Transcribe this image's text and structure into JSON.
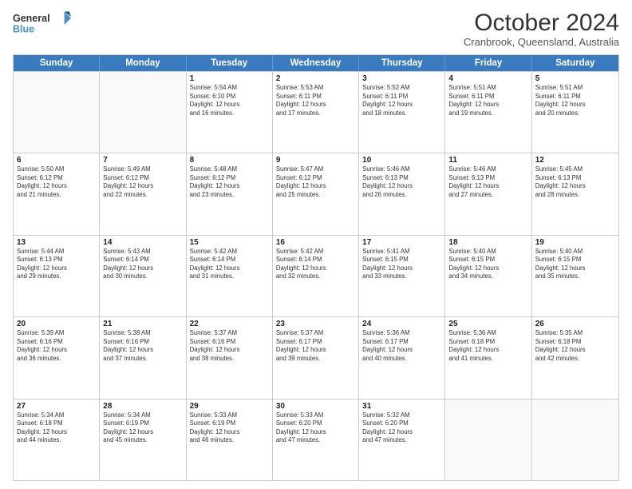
{
  "logo": {
    "line1": "General",
    "line2": "Blue",
    "icon_color": "#4a90c4"
  },
  "title": "October 2024",
  "subtitle": "Cranbrook, Queensland, Australia",
  "header_days": [
    "Sunday",
    "Monday",
    "Tuesday",
    "Wednesday",
    "Thursday",
    "Friday",
    "Saturday"
  ],
  "weeks": [
    [
      {
        "day": "",
        "info": ""
      },
      {
        "day": "",
        "info": ""
      },
      {
        "day": "1",
        "info": "Sunrise: 5:54 AM\nSunset: 6:10 PM\nDaylight: 12 hours\nand 16 minutes."
      },
      {
        "day": "2",
        "info": "Sunrise: 5:53 AM\nSunset: 6:11 PM\nDaylight: 12 hours\nand 17 minutes."
      },
      {
        "day": "3",
        "info": "Sunrise: 5:52 AM\nSunset: 6:11 PM\nDaylight: 12 hours\nand 18 minutes."
      },
      {
        "day": "4",
        "info": "Sunrise: 5:51 AM\nSunset: 6:11 PM\nDaylight: 12 hours\nand 19 minutes."
      },
      {
        "day": "5",
        "info": "Sunrise: 5:51 AM\nSunset: 6:11 PM\nDaylight: 12 hours\nand 20 minutes."
      }
    ],
    [
      {
        "day": "6",
        "info": "Sunrise: 5:50 AM\nSunset: 6:12 PM\nDaylight: 12 hours\nand 21 minutes."
      },
      {
        "day": "7",
        "info": "Sunrise: 5:49 AM\nSunset: 6:12 PM\nDaylight: 12 hours\nand 22 minutes."
      },
      {
        "day": "8",
        "info": "Sunrise: 5:48 AM\nSunset: 6:12 PM\nDaylight: 12 hours\nand 23 minutes."
      },
      {
        "day": "9",
        "info": "Sunrise: 5:47 AM\nSunset: 6:12 PM\nDaylight: 12 hours\nand 25 minutes."
      },
      {
        "day": "10",
        "info": "Sunrise: 5:46 AM\nSunset: 6:13 PM\nDaylight: 12 hours\nand 26 minutes."
      },
      {
        "day": "11",
        "info": "Sunrise: 5:46 AM\nSunset: 6:13 PM\nDaylight: 12 hours\nand 27 minutes."
      },
      {
        "day": "12",
        "info": "Sunrise: 5:45 AM\nSunset: 6:13 PM\nDaylight: 12 hours\nand 28 minutes."
      }
    ],
    [
      {
        "day": "13",
        "info": "Sunrise: 5:44 AM\nSunset: 6:13 PM\nDaylight: 12 hours\nand 29 minutes."
      },
      {
        "day": "14",
        "info": "Sunrise: 5:43 AM\nSunset: 6:14 PM\nDaylight: 12 hours\nand 30 minutes."
      },
      {
        "day": "15",
        "info": "Sunrise: 5:42 AM\nSunset: 6:14 PM\nDaylight: 12 hours\nand 31 minutes."
      },
      {
        "day": "16",
        "info": "Sunrise: 5:42 AM\nSunset: 6:14 PM\nDaylight: 12 hours\nand 32 minutes."
      },
      {
        "day": "17",
        "info": "Sunrise: 5:41 AM\nSunset: 6:15 PM\nDaylight: 12 hours\nand 33 minutes."
      },
      {
        "day": "18",
        "info": "Sunrise: 5:40 AM\nSunset: 6:15 PM\nDaylight: 12 hours\nand 34 minutes."
      },
      {
        "day": "19",
        "info": "Sunrise: 5:40 AM\nSunset: 6:15 PM\nDaylight: 12 hours\nand 35 minutes."
      }
    ],
    [
      {
        "day": "20",
        "info": "Sunrise: 5:39 AM\nSunset: 6:16 PM\nDaylight: 12 hours\nand 36 minutes."
      },
      {
        "day": "21",
        "info": "Sunrise: 5:38 AM\nSunset: 6:16 PM\nDaylight: 12 hours\nand 37 minutes."
      },
      {
        "day": "22",
        "info": "Sunrise: 5:37 AM\nSunset: 6:16 PM\nDaylight: 12 hours\nand 38 minutes."
      },
      {
        "day": "23",
        "info": "Sunrise: 5:37 AM\nSunset: 6:17 PM\nDaylight: 12 hours\nand 39 minutes."
      },
      {
        "day": "24",
        "info": "Sunrise: 5:36 AM\nSunset: 6:17 PM\nDaylight: 12 hours\nand 40 minutes."
      },
      {
        "day": "25",
        "info": "Sunrise: 5:36 AM\nSunset: 6:18 PM\nDaylight: 12 hours\nand 41 minutes."
      },
      {
        "day": "26",
        "info": "Sunrise: 5:35 AM\nSunset: 6:18 PM\nDaylight: 12 hours\nand 42 minutes."
      }
    ],
    [
      {
        "day": "27",
        "info": "Sunrise: 5:34 AM\nSunset: 6:18 PM\nDaylight: 12 hours\nand 44 minutes."
      },
      {
        "day": "28",
        "info": "Sunrise: 5:34 AM\nSunset: 6:19 PM\nDaylight: 12 hours\nand 45 minutes."
      },
      {
        "day": "29",
        "info": "Sunrise: 5:33 AM\nSunset: 6:19 PM\nDaylight: 12 hours\nand 46 minutes."
      },
      {
        "day": "30",
        "info": "Sunrise: 5:33 AM\nSunset: 6:20 PM\nDaylight: 12 hours\nand 47 minutes."
      },
      {
        "day": "31",
        "info": "Sunrise: 5:32 AM\nSunset: 6:20 PM\nDaylight: 12 hours\nand 47 minutes."
      },
      {
        "day": "",
        "info": ""
      },
      {
        "day": "",
        "info": ""
      }
    ]
  ]
}
